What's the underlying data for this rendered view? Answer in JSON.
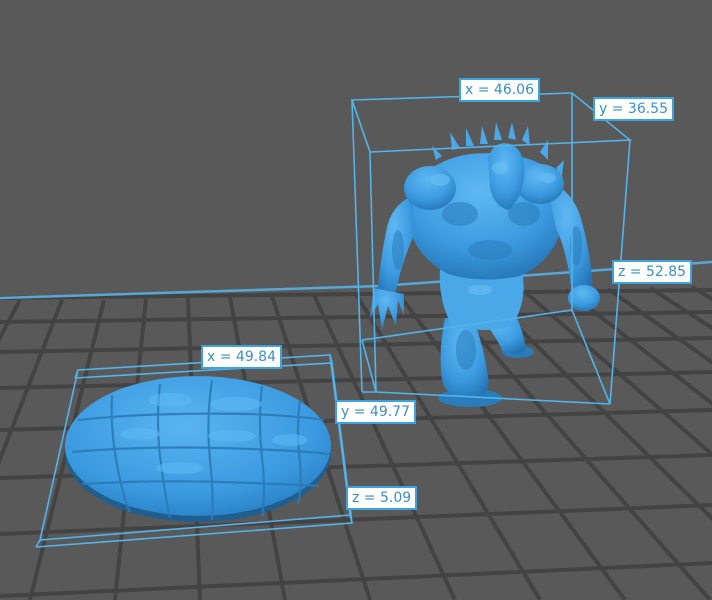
{
  "viewport": {
    "background_color": "#595959",
    "grid_color": "#3f3f3f",
    "bed_edge_color": "#56a8d8",
    "model_color": "#3d9ee0",
    "bbox_color": "#53b4ec"
  },
  "objects": [
    {
      "name": "Base plate",
      "dimensions": {
        "x": "x = 49.84",
        "y": "y = 49.77",
        "z": "z = 5.09"
      }
    },
    {
      "name": "Monster figure",
      "dimensions": {
        "x": "x = 46.06",
        "y": "y = 36.55",
        "z": "z = 52.85"
      }
    }
  ]
}
